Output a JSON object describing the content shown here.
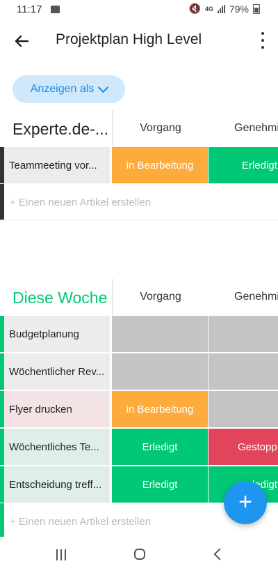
{
  "status": {
    "time": "11:17",
    "network": "4G",
    "battery": "79%"
  },
  "header": {
    "title": "Projektplan High Level",
    "back_icon": "arrow-left-icon",
    "more_icon": "more-vert-icon"
  },
  "view_toggle": {
    "label": "Anzeigen als"
  },
  "columns": {
    "vorgang": "Vorgang",
    "genehmigung": "Genehmi"
  },
  "groups": [
    {
      "title": "Experte.de-...",
      "color": "#333333",
      "rows": [
        {
          "name": "Teammeeting vor...",
          "vorgang": "in Bearbeitung",
          "genehmigung": "Erledigt"
        }
      ],
      "add_label": "+ Einen neuen Artikel erstellen"
    },
    {
      "title": "Diese Woche",
      "color": "#00c875",
      "rows": [
        {
          "name": "Budgetplanung",
          "vorgang": "",
          "genehmigung": ""
        },
        {
          "name": "Wöchentlicher Rev...",
          "vorgang": "",
          "genehmigung": ""
        },
        {
          "name": "Flyer drucken",
          "vorgang": "in Bearbeitung",
          "genehmigung": ""
        },
        {
          "name": "Wöchentliches Te...",
          "vorgang": "Erledigt",
          "genehmigung": "Gestopp"
        },
        {
          "name": "Entscheidung treff...",
          "vorgang": "Erledigt",
          "genehmigung": "Erledigt"
        }
      ],
      "add_label": "+ Einen neuen Artikel erstellen"
    }
  ],
  "status_colors": {
    "in_bearbeitung": "#fdab3d",
    "erledigt": "#00c875",
    "gestoppt": "#e2445c",
    "empty": "#c4c4c4"
  },
  "fab": {
    "icon": "plus-icon",
    "label": "+"
  },
  "nav": {
    "recents_icon": "recents-icon",
    "home_icon": "home-icon",
    "back_icon": "back-chevron-icon"
  }
}
